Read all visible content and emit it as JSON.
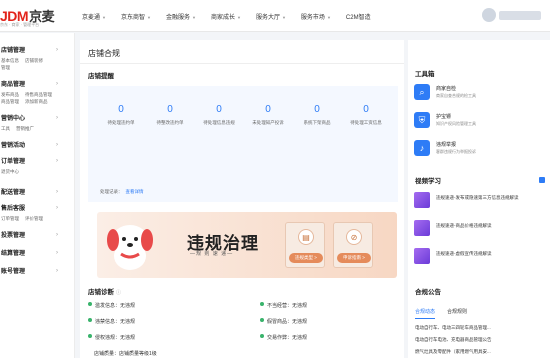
{
  "header": {
    "logo_text": "JDM",
    "logo_cn": "京麦",
    "logo_sub": "京东 · 商家 · 管理平台",
    "nav": [
      "京麦通",
      "京东商智",
      "金融服务",
      "商家成长",
      "服务大厅",
      "服务市场",
      "C2M智造"
    ]
  },
  "sidebar": {
    "groups": [
      {
        "title": "店铺管理",
        "subs": [
          "基本信息",
          "店铺装修",
          "管理"
        ]
      },
      {
        "title": "商品管理",
        "subs": [
          "发布商品",
          "待售商品管理",
          "商品管理",
          "添加新商品"
        ]
      },
      {
        "title": "营销中心",
        "subs": [
          "工具",
          "营销推广"
        ]
      },
      {
        "title": "营销活动",
        "subs": []
      },
      {
        "title": "订单管理",
        "subs": [
          "退货中心"
        ]
      },
      {
        "title": "配送管理",
        "subs": []
      },
      {
        "title": "售后客服",
        "subs": [
          "订单管理",
          "评价管理"
        ]
      },
      {
        "title": "投票管理",
        "subs": []
      },
      {
        "title": "结算管理",
        "subs": []
      },
      {
        "title": "账号管理",
        "subs": []
      }
    ]
  },
  "main": {
    "page_title": "店铺合规",
    "remind_title": "店铺提醒",
    "stats": [
      {
        "num": "0",
        "label": "待处理违约单"
      },
      {
        "num": "0",
        "label": "待整改违约单"
      },
      {
        "num": "0",
        "label": "待处理信息违规"
      },
      {
        "num": "0",
        "label": "未处理知产投诉"
      },
      {
        "num": "0",
        "label": "系统下架商品"
      },
      {
        "num": "0",
        "label": "待处理工资信息"
      }
    ],
    "record_label": "处理记录：",
    "record_link": "查看详情",
    "banner": {
      "title": "违规治理",
      "subtitle": "—规 则 速 递—",
      "btn1": "违规类型 >",
      "btn2": "申诉指南 >"
    },
    "diag_title": "店铺诊断",
    "diag_items": [
      "滥发信息：无违规",
      "不当经营：无违规",
      "违禁信息：无违规",
      "假冒商品：无违规",
      "侵权违规：无违规",
      "交易作弊：无违规"
    ],
    "diag_level": "店铺质量：店铺质量等级1级"
  },
  "right": {
    "tools_title": "工具箱",
    "tools": [
      {
        "name": "商家自检",
        "desc": "商家自查合规的检工具",
        "icon": "magnifier"
      },
      {
        "name": "护宝镖",
        "desc": "知识产权风险管理工具",
        "icon": "shield"
      },
      {
        "name": "违规举报",
        "desc": "客群违规行为举报投诉",
        "icon": "bell"
      }
    ],
    "video_title": "视频学习",
    "videos": [
      "违规速递-发布或隐速第三方信息违规解读",
      "违规速递-商品价格违规解读",
      "违规速递-虚假宣传违规解读"
    ],
    "notice_title": "合规公告",
    "tabs": [
      "合规动态",
      "合规规则"
    ],
    "notices": [
      "电动自行车、电动三四轮车商品管理...",
      "电动自行车电池、充电器商品管理公告",
      "燃气灶具及零配件（家用燃气用具安..."
    ],
    "accent_color": "#2e7cf6",
    "brand_color": "#e2231a"
  }
}
